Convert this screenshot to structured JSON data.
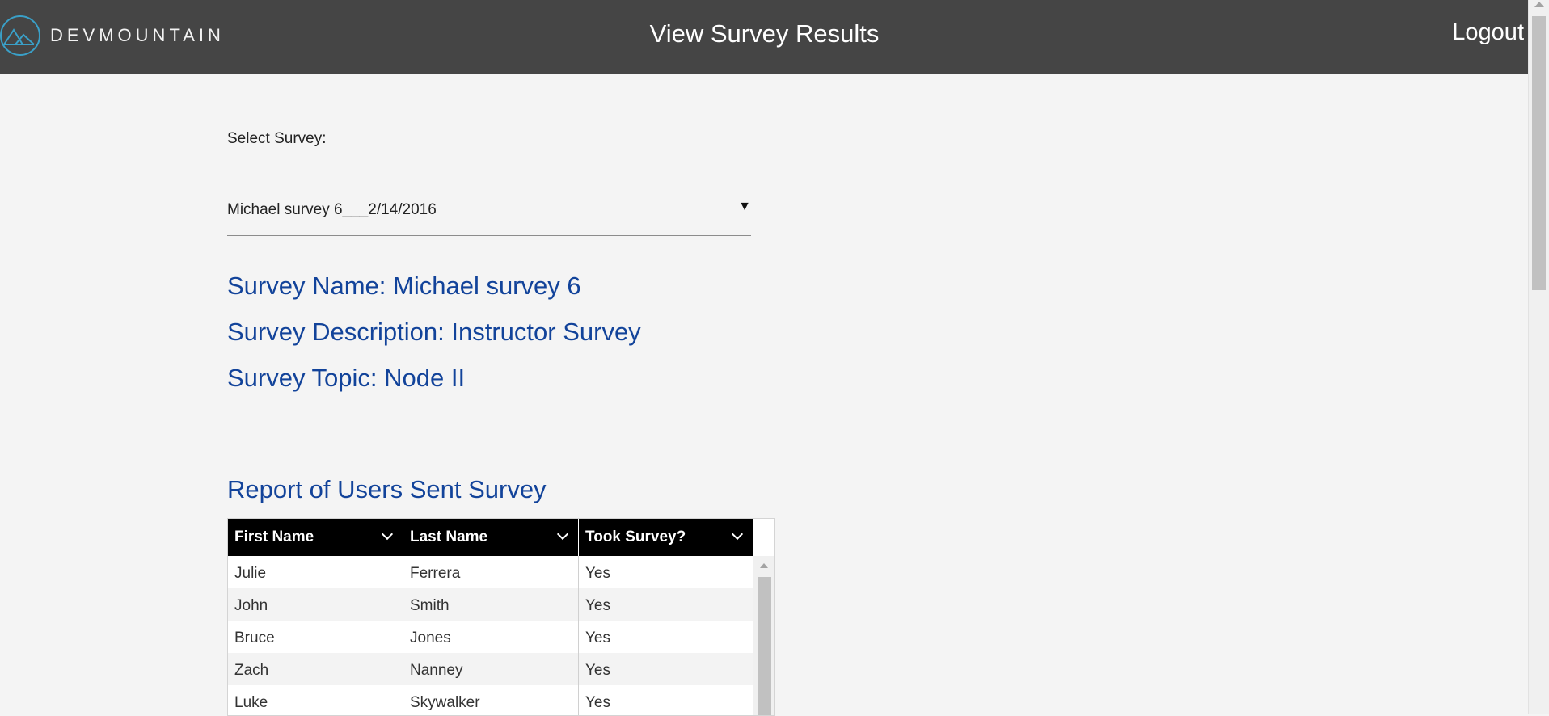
{
  "header": {
    "logo_text": "DEVMOUNTAIN",
    "title": "View Survey Results",
    "logout_label": "Logout"
  },
  "survey_select": {
    "label": "Select Survey:",
    "value": "Michael survey 6___2/14/2016"
  },
  "survey_info": {
    "name": "Survey Name: Michael survey 6",
    "description": "Survey Description: Instructor Survey",
    "topic": "Survey Topic: Node II"
  },
  "report": {
    "title": "Report of Users Sent Survey",
    "columns": [
      "First Name",
      "Last Name",
      "Took Survey?"
    ],
    "rows": [
      [
        "Julie",
        "Ferrera",
        "Yes"
      ],
      [
        "John",
        "Smith",
        "Yes"
      ],
      [
        "Bruce",
        "Jones",
        "Yes"
      ],
      [
        "Zach",
        "Nanney",
        "Yes"
      ],
      [
        "Luke",
        "Skywalker",
        "Yes"
      ]
    ]
  },
  "colors": {
    "header_bg": "#454545",
    "accent_blue": "#12439a",
    "logo_teal": "#3aa0c8",
    "page_bg": "#f4f4f4"
  },
  "icons": {
    "logo": "mountain-logo-icon",
    "select_arrow": "caret-down-icon",
    "column_menu": "chevron-down-icon"
  }
}
